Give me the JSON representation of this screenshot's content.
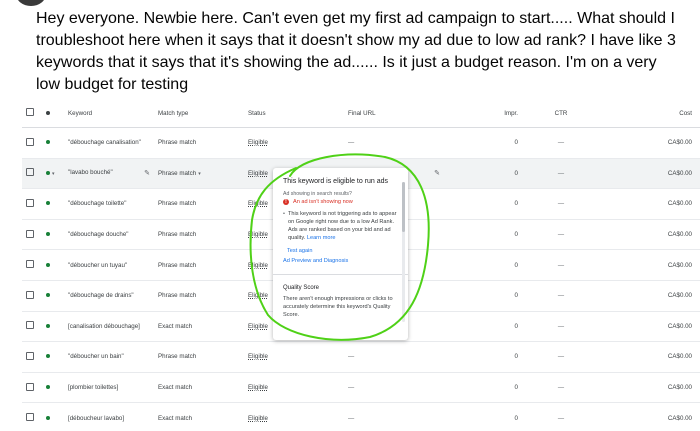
{
  "post": {
    "text": "Hey everyone. Newbie here. Can't even get my first ad campaign to start..... What should I troubleshoot here when it says that it doesn't show my ad due to low ad rank? I have like 3 keywords that it says that it's showing the ad...... Is it just a budget reason. I'm on a very low budget for testing"
  },
  "table": {
    "headers": {
      "keyword": "Keyword",
      "match_type": "Match type",
      "status": "Status",
      "final_url": "Final URL",
      "impr": "Impr.",
      "ctr": "CTR",
      "cost": "Cost"
    },
    "rows": [
      {
        "keyword": "\"débouchage canalisation\"",
        "match": "Phrase match",
        "status": "Eligible",
        "url": "—",
        "impr": "0",
        "ctr": "—",
        "cost": "CA$0.00"
      },
      {
        "keyword": "\"lavabo bouché\"",
        "match": "Phrase match",
        "status": "Eligible",
        "url": "",
        "impr": "0",
        "ctr": "—",
        "cost": "CA$0.00"
      },
      {
        "keyword": "\"débouchage toilette\"",
        "match": "Phrase match",
        "status": "Eligible",
        "url": "",
        "impr": "0",
        "ctr": "—",
        "cost": "CA$0.00"
      },
      {
        "keyword": "\"débouchage douche\"",
        "match": "Phrase match",
        "status": "Eligible",
        "url": "",
        "impr": "0",
        "ctr": "—",
        "cost": "CA$0.00"
      },
      {
        "keyword": "\"déboucher un tuyau\"",
        "match": "Phrase match",
        "status": "Eligible",
        "url": "",
        "impr": "0",
        "ctr": "—",
        "cost": "CA$0.00"
      },
      {
        "keyword": "\"débouchage de drains\"",
        "match": "Phrase match",
        "status": "Eligible",
        "url": "",
        "impr": "0",
        "ctr": "—",
        "cost": "CA$0.00"
      },
      {
        "keyword": "[canalisation débouchage]",
        "match": "Exact match",
        "status": "Eligible",
        "url": "",
        "impr": "0",
        "ctr": "—",
        "cost": "CA$0.00"
      },
      {
        "keyword": "\"déboucher un bain\"",
        "match": "Phrase match",
        "status": "Eligible",
        "url": "—",
        "impr": "0",
        "ctr": "—",
        "cost": "CA$0.00"
      },
      {
        "keyword": "[plombier toilettes]",
        "match": "Exact match",
        "status": "Eligible",
        "url": "—",
        "impr": "0",
        "ctr": "—",
        "cost": "CA$0.00"
      },
      {
        "keyword": "[déboucheur lavabo]",
        "match": "Exact match",
        "status": "Eligible",
        "url": "—",
        "impr": "0",
        "ctr": "—",
        "cost": "CA$0.00"
      }
    ]
  },
  "popup": {
    "title": "This keyword is eligible to run ads",
    "question": "Ad showing in search results?",
    "status": "An ad isn't showing now",
    "explanation": "This keyword is not triggering ads to appear on Google right now due to a low Ad Rank. Ads are ranked based on your bid and ad quality.",
    "learn_more": "Learn more",
    "test_again": "Test again",
    "preview_link": "Ad Preview and Diagnosis",
    "qs_title": "Quality Score",
    "qs_text": "There aren't enough impressions or clicks to accurately determine this keyword's Quality Score."
  },
  "colors": {
    "annotation_circle": "#4fd117",
    "enabled_dot": "#188038",
    "error_red": "#d93025",
    "link_blue": "#1a73e8"
  },
  "icons": {
    "pencil": "pencil-icon",
    "error": "error-icon",
    "status_dot": "status-dot-icon"
  }
}
